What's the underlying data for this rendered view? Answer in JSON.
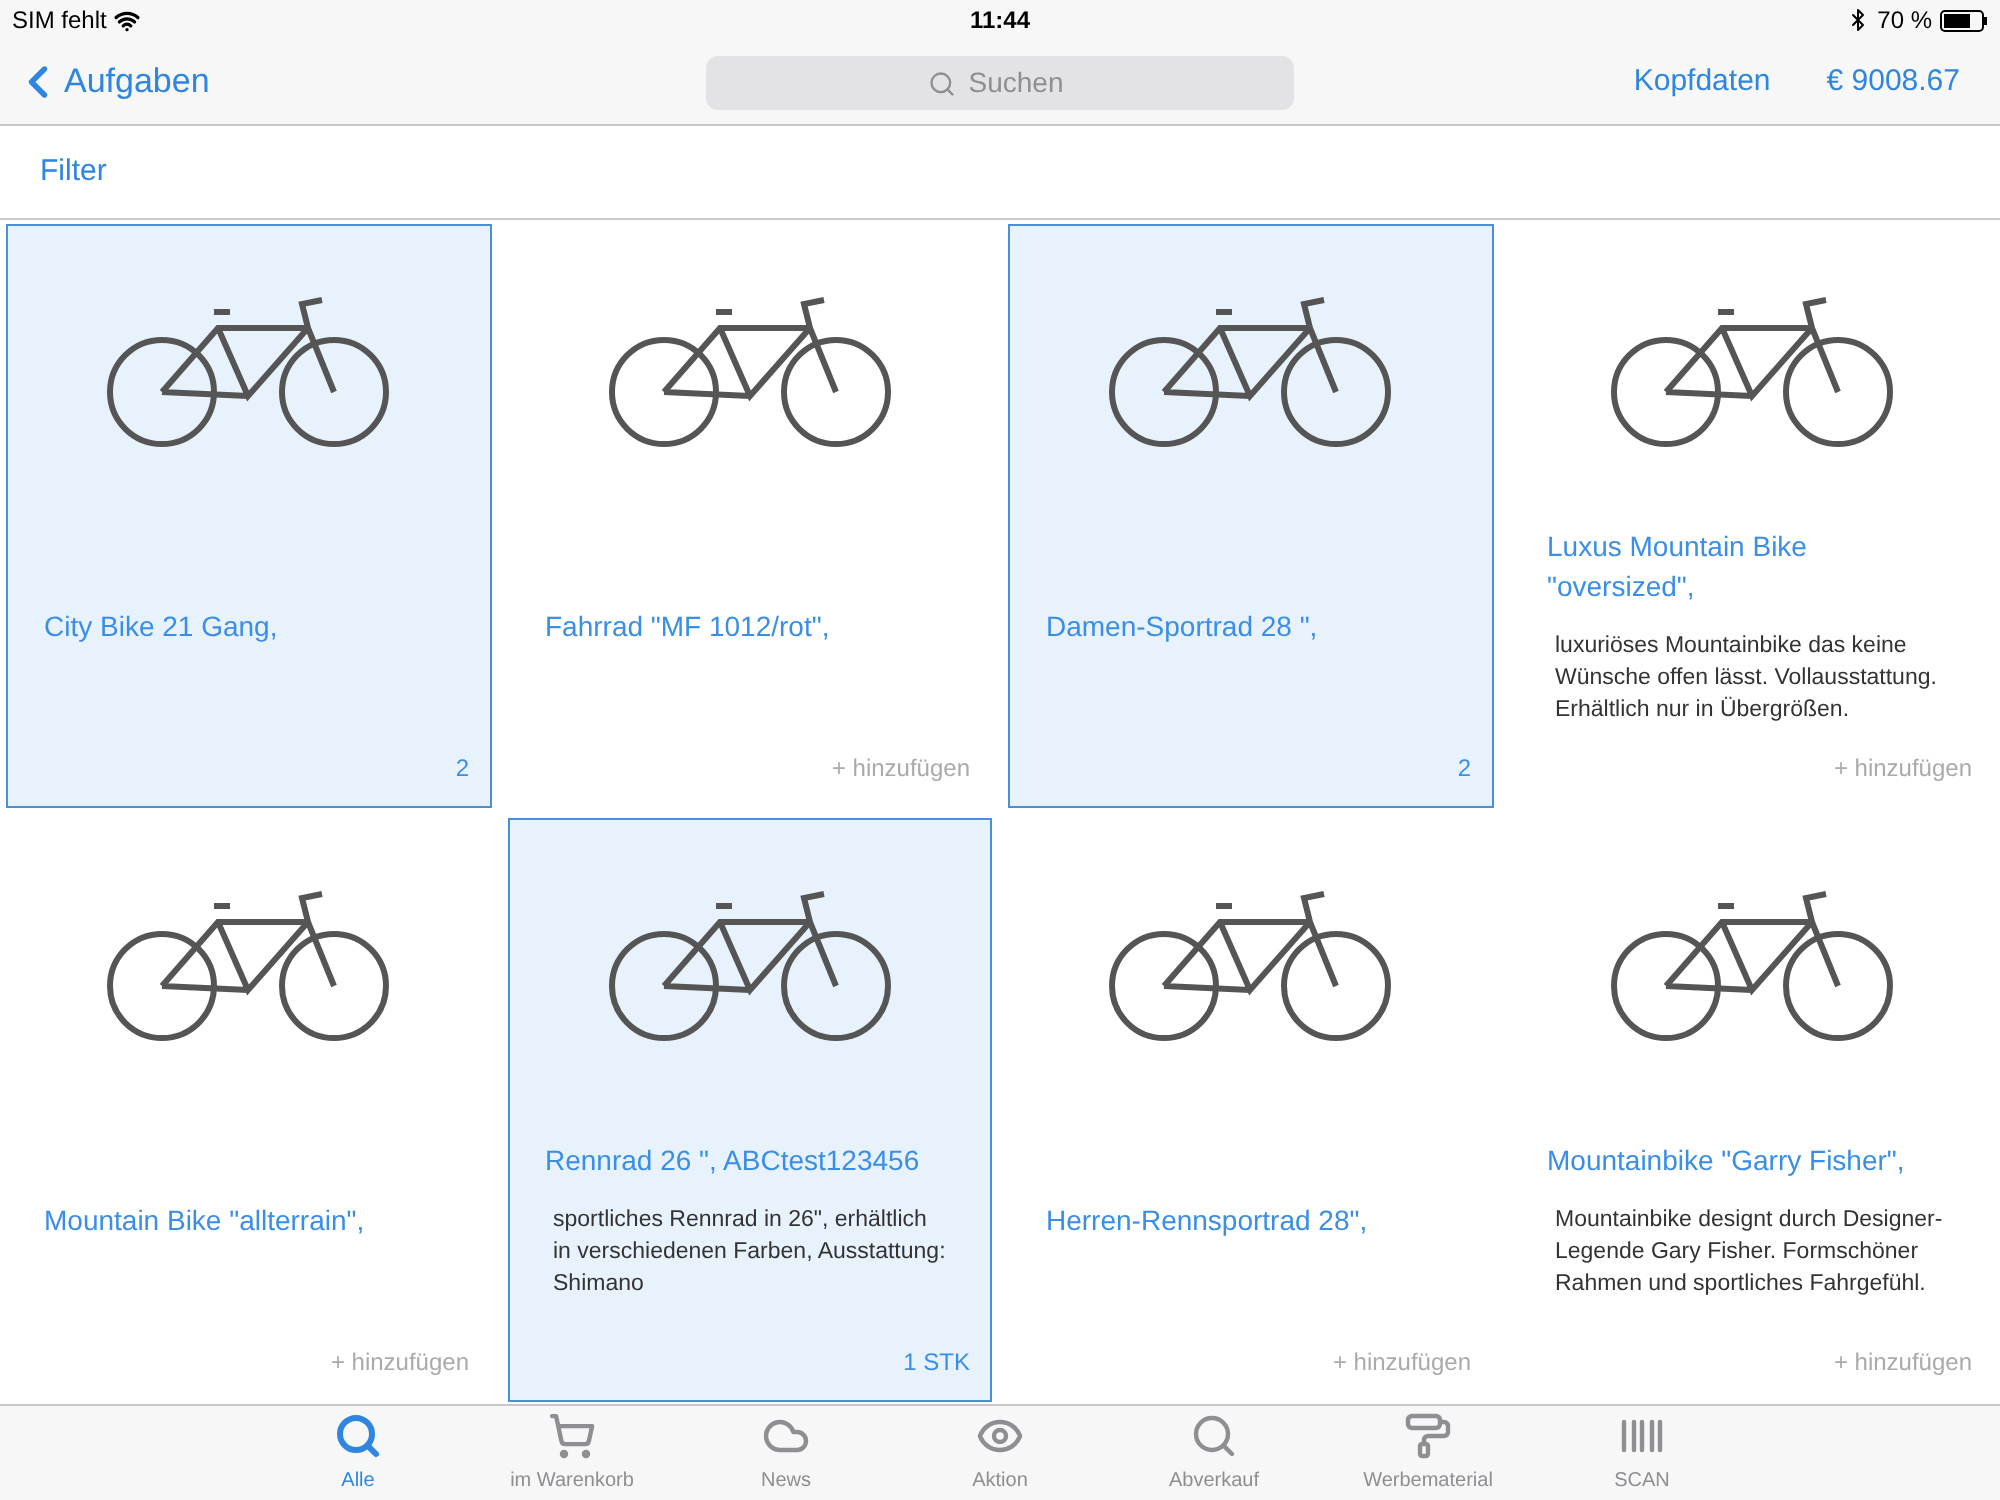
{
  "status_bar": {
    "carrier": "SIM fehlt",
    "time": "11:44",
    "battery": "70 %"
  },
  "nav_bar": {
    "back": "Aufgaben",
    "search": {
      "placeholder": "Suchen"
    },
    "header_link": "Kopfdaten",
    "total": "€ 9008.67"
  },
  "filter": "Filter",
  "products": [
    {
      "title": "City Bike 21 Gang,",
      "selected": true,
      "footer": "2"
    },
    {
      "title": "Fahrrad \"MF 1012/rot\",",
      "selected": false,
      "footer": "+ hinzufügen"
    },
    {
      "title": "Damen-Sportrad 28 \",",
      "selected": true,
      "footer": "2"
    },
    {
      "title": "Luxus Mountain Bike \"oversized\",",
      "description": "luxuriöses Mountainbike das keine Wünsche offen lässt. Vollausstattung. Erhältlich nur in Übergrößen.",
      "selected": false,
      "footer": "+ hinzufügen"
    },
    {
      "title": "Mountain Bike \"allterrain\",",
      "selected": false,
      "footer": "+ hinzufügen"
    },
    {
      "title": "Rennrad 26 \", ABCtest123456",
      "description": "sportliches Rennrad in 26\", erhältlich in verschiedenen Farben, Ausstattung: Shimano",
      "selected": true,
      "footer": "1 STK"
    },
    {
      "title": "Herren-Rennsportrad 28\",",
      "selected": false,
      "footer": "+ hinzufügen"
    },
    {
      "title": "Mountainbike \"Garry Fisher\",",
      "description": "Mountainbike designt durch Designer-Legende Gary Fisher. Formschöner Rahmen und sportliches Fahrgefühl.",
      "selected": false,
      "footer": "+ hinzufügen"
    }
  ],
  "tab_bar": [
    {
      "label": "Alle",
      "selected": true
    },
    {
      "label": "im Warenkorb",
      "selected": false
    },
    {
      "label": "News",
      "selected": false
    },
    {
      "label": "Aktion",
      "selected": false
    },
    {
      "label": "Abverkauf",
      "selected": false
    },
    {
      "label": "Werbematerial",
      "selected": false
    },
    {
      "label": "SCAN",
      "selected": false
    }
  ]
}
